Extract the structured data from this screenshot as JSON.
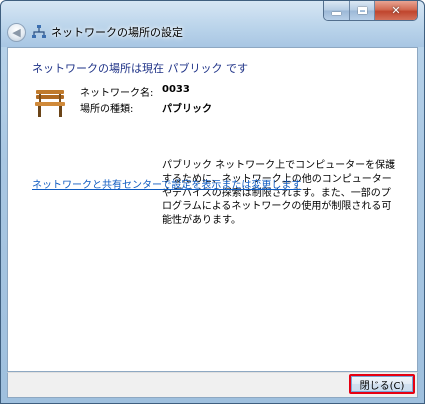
{
  "window": {
    "title": "ネットワークの場所の設定"
  },
  "caption_buttons": {
    "close_glyph": "✕"
  },
  "headline": "ネットワークの場所は現在 パブリック です",
  "info": {
    "network_name_label": "ネットワーク名:",
    "network_name_value": "0033",
    "location_type_label": "場所の種類:",
    "location_type_value": "パブリック",
    "description": "パブリック ネットワーク上でコンピューターを保護するために、ネットワーク上の他のコンピューターやデバイスの探索は制限されます。また、一部のプログラムによるネットワークの使用が制限される可能性があります。"
  },
  "link_text": "ネットワークと共有センターで設定を表示または変更します",
  "footer": {
    "close_button_label": "閉じる(C)",
    "close_button_highlight": "#e60012"
  },
  "icons": {
    "back": "back-arrow-icon",
    "network": "network-icon",
    "location": "park-bench-icon"
  }
}
